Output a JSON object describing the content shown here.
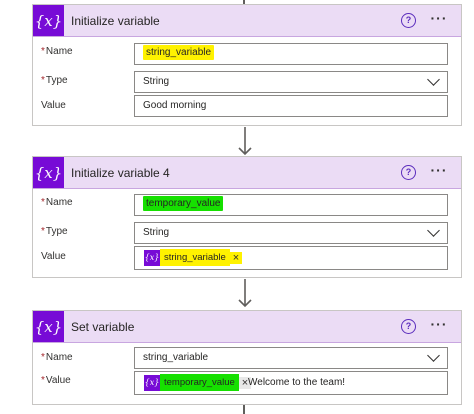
{
  "icons": {
    "variable_glyph": "{x}",
    "help_glyph": "?",
    "more_glyph": "···",
    "close_glyph": "×"
  },
  "labels": {
    "required_mark": "*",
    "name": "Name",
    "type": "Type",
    "value": "Value"
  },
  "colors": {
    "action_accent": "#770bd6",
    "header_background": "#ebdcf5",
    "highlight_yellow": "#fff200",
    "highlight_green": "#16e000"
  },
  "actions": [
    {
      "title": "Initialize variable",
      "name": "string_variable",
      "type": "String",
      "value": "Good morning"
    },
    {
      "title": "Initialize variable 4",
      "name": "temporary_value",
      "type": "String",
      "value_token": "string_variable"
    },
    {
      "title": "Set variable",
      "name": "string_variable",
      "value_token": "temporary_value",
      "value_text": "Welcome to the team!"
    }
  ]
}
